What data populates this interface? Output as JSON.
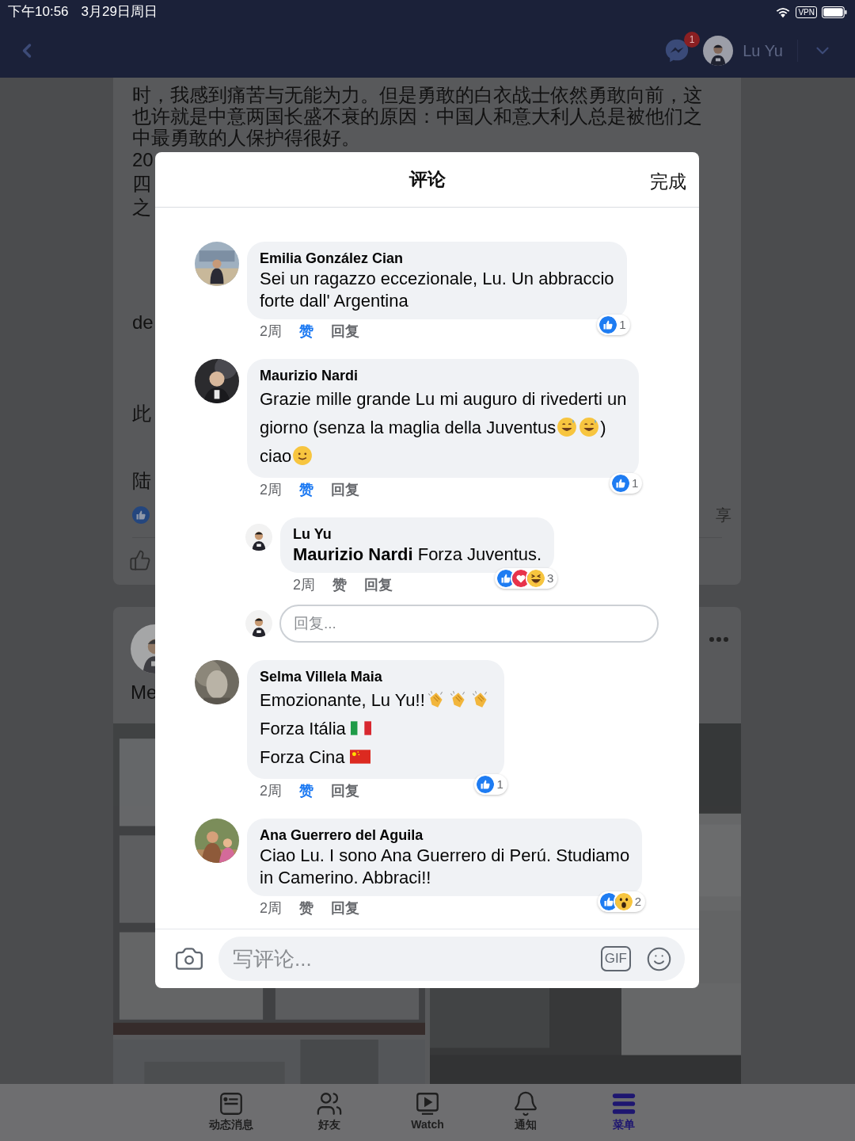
{
  "status_bar": {
    "time": "下午10:56",
    "date": "3月29日周日",
    "vpn": "VPN"
  },
  "header": {
    "message_badge": "1",
    "user_name": "Lu Yu"
  },
  "post": {
    "text_lines": [
      "时，我感到痛苦与无能为力。但是勇敢的白衣战士依然勇敢向前，这",
      "也许就是中意两国长盛不衰的原因：中国人和意大利人总是被他们之",
      "中最勇敢的人保护得很好。"
    ],
    "fragments": [
      "20",
      "四",
      "之"
    ],
    "later_fragments": [
      "de",
      "此",
      "陆"
    ],
    "share_label": "享"
  },
  "post2": {
    "author_fragment": "Me"
  },
  "comments_dialog": {
    "title": "评论",
    "done": "完成",
    "comments": [
      {
        "author": "Emilia González Cian",
        "lines": [
          [
            {
              "kind": "text",
              "text": "Sei un ragazzo eccezionale, Lu. Un abbraccio"
            }
          ],
          [
            {
              "kind": "text",
              "text": "forte dall' Argentina"
            }
          ]
        ],
        "time": "2周",
        "like_label": "赞",
        "liked": true,
        "reply_label": "回复",
        "reactions": [
          {
            "kind": "like"
          }
        ],
        "reaction_count": "1"
      },
      {
        "author": "Maurizio Nardi",
        "lines": [
          [
            {
              "kind": "text",
              "text": "Grazie mille grande Lu mi auguro di rivederti un"
            }
          ],
          [
            {
              "kind": "text",
              "text": "giorno (senza la maglia della Juventus"
            },
            {
              "kind": "sweat-smile"
            },
            {
              "kind": "sweat-smile"
            },
            {
              "kind": "text",
              "text": ")"
            }
          ],
          [
            {
              "kind": "text",
              "text": "ciao"
            },
            {
              "kind": "smile"
            }
          ]
        ],
        "time": "2周",
        "like_label": "赞",
        "liked": true,
        "reply_label": "回复",
        "reactions": [
          {
            "kind": "like"
          }
        ],
        "reaction_count": "1",
        "replies": [
          {
            "author": "Lu Yu",
            "lines": [
              [
                {
                  "kind": "text",
                  "text": "**Maurizio Nardi** Forza Juventus."
                }
              ]
            ],
            "time": "2周",
            "like_label": "赞",
            "liked": false,
            "reply_label": "回复",
            "reactions": [
              {
                "kind": "like"
              },
              {
                "kind": "love"
              },
              {
                "kind": "haha"
              }
            ],
            "reaction_count": "3"
          }
        ],
        "reply_field": {
          "placeholder": "回复..."
        }
      },
      {
        "author": "Selma Villela Maia",
        "lines": [
          [
            {
              "kind": "text",
              "text": "Emozionante, Lu Yu!!"
            },
            {
              "kind": "clap"
            },
            {
              "kind": "clap"
            },
            {
              "kind": "clap"
            }
          ],
          [
            {
              "kind": "text",
              "text": "Forza Itália"
            },
            {
              "kind": "flag-it"
            }
          ],
          [
            {
              "kind": "text",
              "text": "Forza Cina"
            },
            {
              "kind": "flag-cn"
            }
          ]
        ],
        "time": "2周",
        "like_label": "赞",
        "liked": true,
        "reply_label": "回复",
        "reactions": [
          {
            "kind": "like"
          }
        ],
        "reaction_count": "1"
      },
      {
        "author": "Ana Guerrero del Aguila",
        "lines": [
          [
            {
              "kind": "text",
              "text": "Ciao Lu. I sono Ana Guerrero di Perú. Studiamo"
            }
          ],
          [
            {
              "kind": "text",
              "text": "in Camerino. Abbraci!!"
            }
          ]
        ],
        "time": "2周",
        "like_label": "赞",
        "liked": false,
        "reply_label": "回复",
        "reactions": [
          {
            "kind": "like"
          },
          {
            "kind": "wow"
          }
        ],
        "reaction_count": "2"
      }
    ],
    "composer": {
      "placeholder": "写评论...",
      "gif_label": "GIF"
    }
  },
  "bottom_nav": [
    {
      "label": "动态消息",
      "selected": false
    },
    {
      "label": "好友",
      "selected": false
    },
    {
      "label": "Watch",
      "selected": false
    },
    {
      "label": "通知",
      "selected": false
    },
    {
      "label": "菜单",
      "selected": true
    }
  ]
}
